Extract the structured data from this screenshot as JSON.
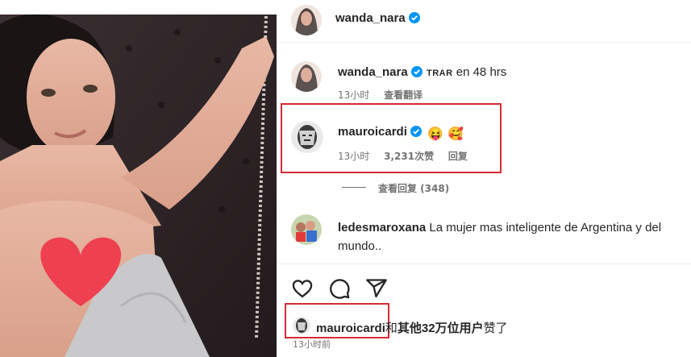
{
  "header": {
    "username": "wanda_nara"
  },
  "comments": [
    {
      "username": "wanda_nara",
      "text": "TRAR en 48 hrs",
      "tag": "TRAR",
      "body": "en 48 hrs",
      "time": "13小时",
      "action": "查看翻译"
    },
    {
      "username": "mauroicardi",
      "emojis": [
        "😝",
        "🥰"
      ],
      "time": "13小时",
      "likes": "3,231次赞",
      "reply": "回复",
      "replies_toggle": "查看回复 (348)"
    },
    {
      "username": "ledesmaroxana",
      "text": "La mujer mas inteligente de Argentina y del",
      "text2": "mundo.."
    }
  ],
  "likes_line": {
    "username": "mauroicardi",
    "connector": "和",
    "others": "其他32万位用户",
    "suffix": "赞了"
  },
  "timestamp": "13小时前",
  "icons": [
    "heart-icon",
    "comment-icon",
    "share-icon",
    "verified-badge-icon"
  ],
  "colors": {
    "accent": "#0095f6",
    "highlight": "#d62b35",
    "muted": "#737373"
  }
}
